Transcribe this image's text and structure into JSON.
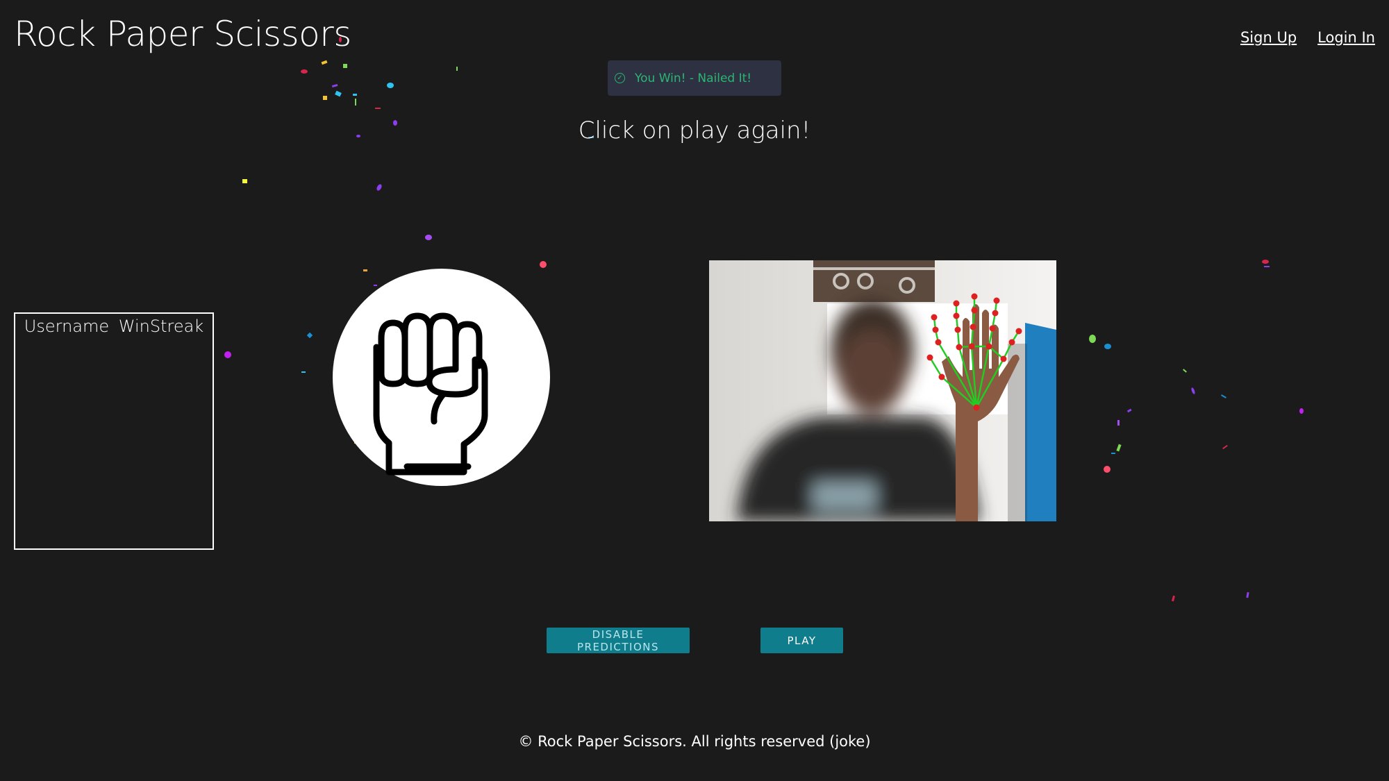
{
  "header": {
    "app_title": "Rock Paper Scissors",
    "nav": {
      "sign_up": "Sign Up",
      "login": "Login In"
    }
  },
  "toast": {
    "icon": "check-circle-icon",
    "message": "You Win! - Nailed It!",
    "color": "#2bb673"
  },
  "game": {
    "status_text": "Click on play again!",
    "computer_move_icon": "rock-fist-icon"
  },
  "leaderboard": {
    "columns": [
      "Username",
      "WinStreak"
    ],
    "rows": []
  },
  "controls": {
    "disable_predictions_label": "DISABLE PREDICTIONS",
    "play_label": "PLAY",
    "accent_color": "#0f7d8c"
  },
  "footer": {
    "text": "© Rock Paper Scissors. All rights reserved (joke)"
  }
}
